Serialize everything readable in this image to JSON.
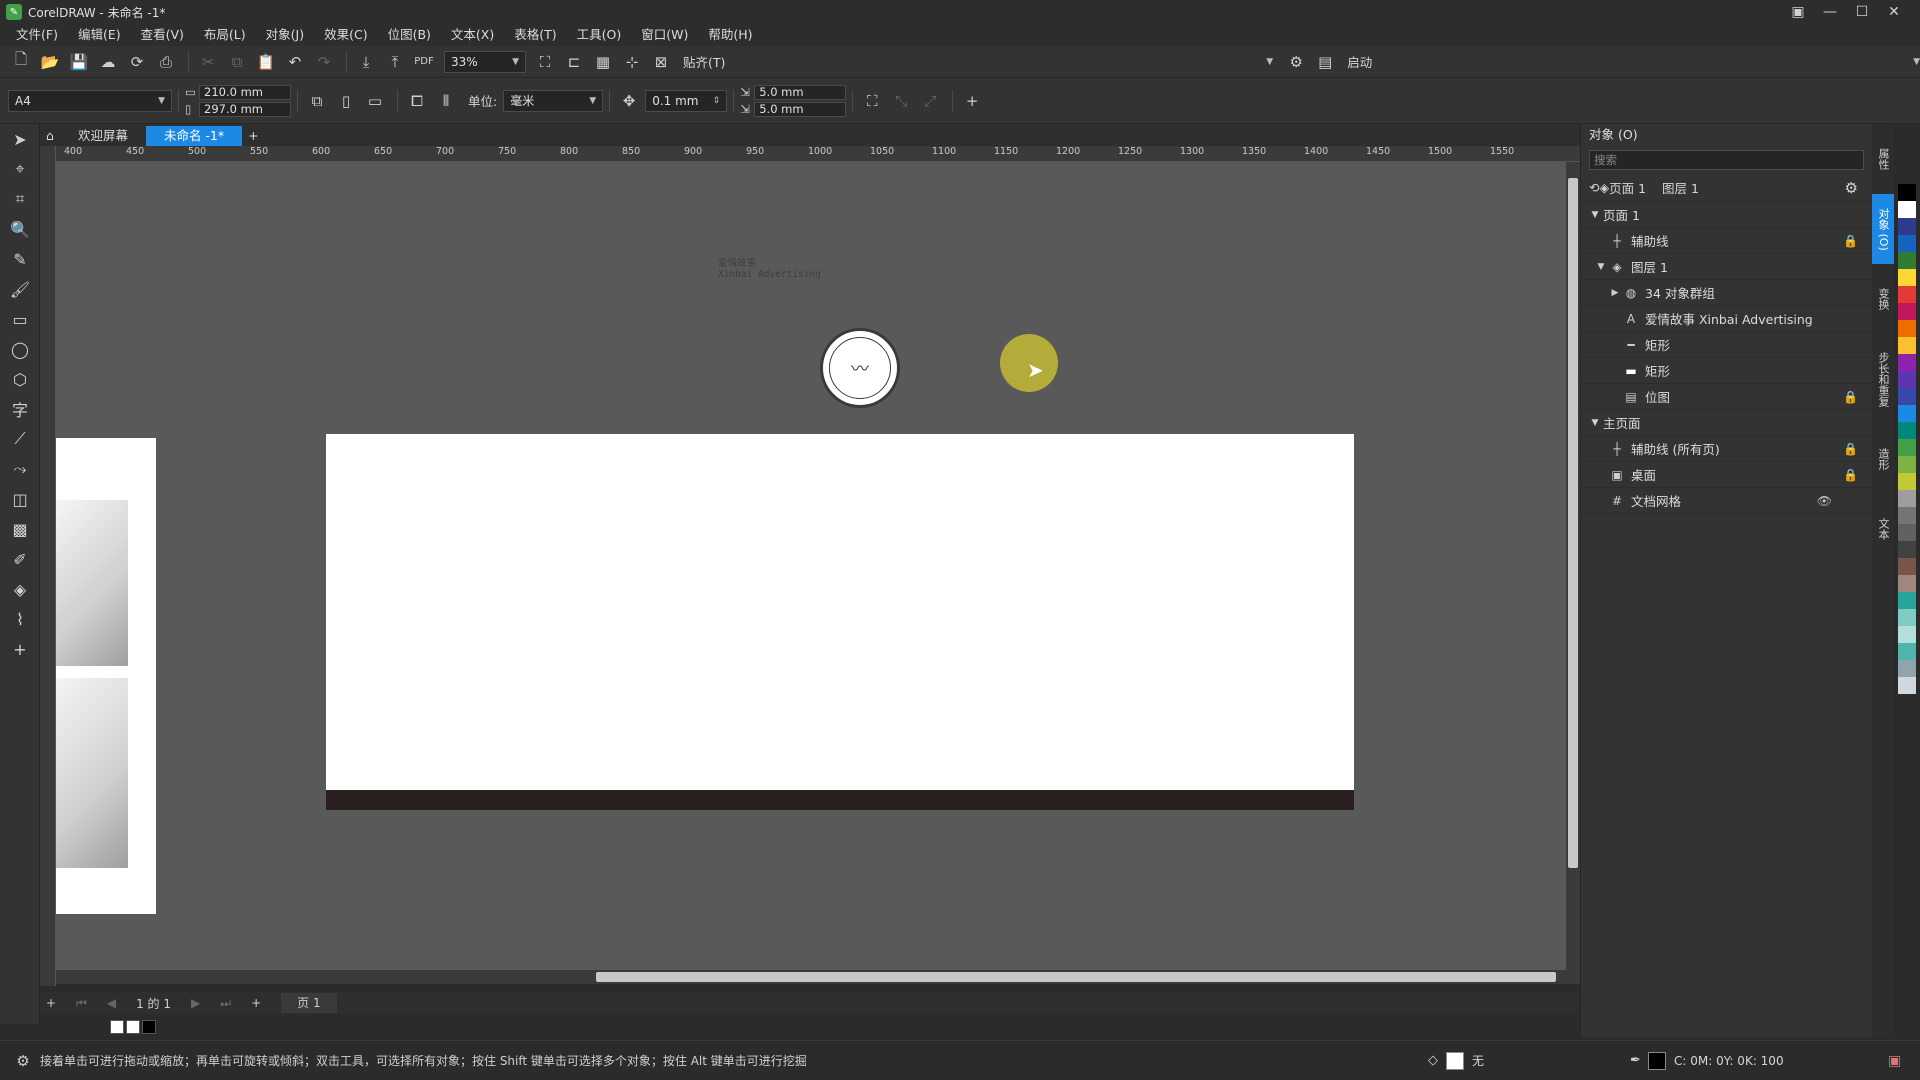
{
  "window": {
    "title": "CorelDRAW - 未命名 -1*"
  },
  "menu": [
    "文件(F)",
    "编辑(E)",
    "查看(V)",
    "布局(L)",
    "对象(J)",
    "效果(C)",
    "位图(B)",
    "文本(X)",
    "表格(T)",
    "工具(O)",
    "窗口(W)",
    "帮助(H)"
  ],
  "toolbar1": {
    "zoom": "33%",
    "snap_label": "贴齐(T)",
    "launch_label": "启动"
  },
  "propbar": {
    "page_size": "A4",
    "width": "210.0 mm",
    "height": "297.0 mm",
    "unit_label": "单位:",
    "unit_value": "毫米",
    "nudge": "0.1 mm",
    "dup_x": "5.0 mm",
    "dup_y": "5.0 mm"
  },
  "doc_tabs": {
    "welcome": "欢迎屏幕",
    "active": "未命名 -1*"
  },
  "ruler_ticks": [
    "400",
    "450",
    "500",
    "550",
    "600",
    "650",
    "700",
    "750",
    "800",
    "850",
    "900",
    "950",
    "1000",
    "1050",
    "1100",
    "1150",
    "1200",
    "1250",
    "1300",
    "1350",
    "1400",
    "1450",
    "1500",
    "1550"
  ],
  "canvas": {
    "brand_line1": "爱情故事",
    "brand_line2": "Xinbai Advertising"
  },
  "pagenav": {
    "count": "1 的 1",
    "page_tab": "页 1"
  },
  "objects_docker": {
    "title": "对象 (O)",
    "search_placeholder": "搜索",
    "context_page": "页面 1",
    "context_layer": "图层 1",
    "tree": [
      {
        "label": "页面 1",
        "level": 0,
        "arrow": "▼"
      },
      {
        "label": "辅助线",
        "level": 1,
        "icon": "guides"
      },
      {
        "label": "图层 1",
        "level": 1,
        "arrow": "▼",
        "icon": "layer"
      },
      {
        "label": "34 对象群组",
        "level": 2,
        "arrow": "▶",
        "icon": "group"
      },
      {
        "label": "爱情故事 Xinbai Advertising",
        "level": 2,
        "icon": "text"
      },
      {
        "label": "矩形",
        "level": 2,
        "icon": "rect-line"
      },
      {
        "label": "矩形",
        "level": 2,
        "icon": "rect-fill"
      },
      {
        "label": "位图",
        "level": 2,
        "icon": "bitmap"
      },
      {
        "label": "主页面",
        "level": 0,
        "arrow": "▼"
      },
      {
        "label": "辅助线 (所有页)",
        "level": 1,
        "icon": "guides"
      },
      {
        "label": "桌面",
        "level": 1,
        "icon": "desktop"
      },
      {
        "label": "文档网格",
        "level": 1,
        "icon": "grid"
      }
    ]
  },
  "side_tabs": [
    "属性",
    "对象 (O)",
    "变换",
    "步长和重复",
    "造形",
    "文本"
  ],
  "statusbar": {
    "hint": "接着单击可进行拖动或缩放；再单击可旋转或倾斜；双击工具，可选择所有对象；按住 Shift 键单击可选择多个对象；按住 Alt 键单击可进行挖掘",
    "fill_label": "无",
    "color_readout": "C: 0M: 0Y: 0K: 100"
  },
  "colors": {
    "accent": "#1e88e5",
    "palette": [
      "#000000",
      "#ffffff",
      "#2e3a8c",
      "#1565c0",
      "#2e7d32",
      "#fdd835",
      "#e53935",
      "#c2185b",
      "#ef6c00",
      "#fbc02d",
      "#8e24aa",
      "#5e35b1",
      "#3949ab",
      "#1e88e5",
      "#00897b",
      "#43a047",
      "#7cb342",
      "#c0ca33",
      "#9e9e9e",
      "#757575",
      "#616161",
      "#424242",
      "#795548",
      "#a1887f",
      "#26a69a",
      "#80cbc4",
      "#b2dfdb",
      "#4db6ac",
      "#90a4ae",
      "#cfd8dc"
    ]
  }
}
